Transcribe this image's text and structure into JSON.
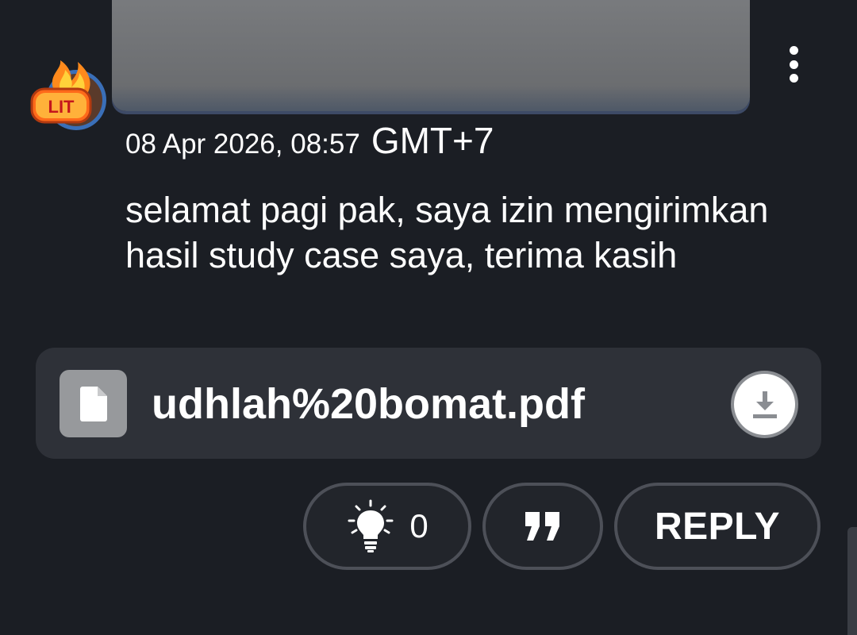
{
  "post": {
    "timestamp_date": "08 Apr 2026, 08:57",
    "timestamp_zone": "GMT+7",
    "message": "selamat pagi pak, saya izin mengirimkan hasil study case saya, terima kasih",
    "avatar_badge": "LIT",
    "avatar_icon": "lit-fire-icon"
  },
  "attachment": {
    "file_name": "udhlah%20bomat.pdf",
    "file_icon": "document-icon",
    "download_icon": "download-icon"
  },
  "actions": {
    "like_icon": "lightbulb-icon",
    "like_count": "0",
    "quote_icon": "quote-icon",
    "reply_label": "REPLY"
  },
  "menu": {
    "icon": "more-vertical-icon"
  },
  "colors": {
    "background": "#1b1e24",
    "card": "#2e3138",
    "pill_border": "#4d5058",
    "text": "#ffffff"
  }
}
